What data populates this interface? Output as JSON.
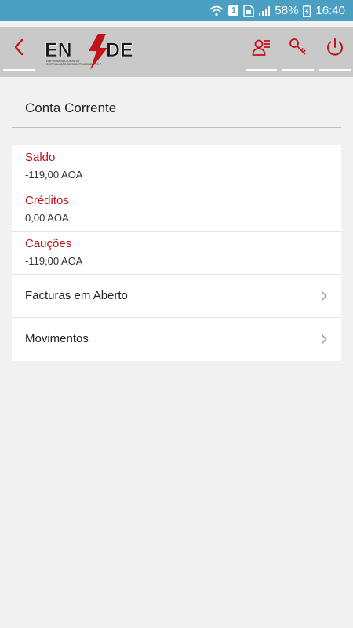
{
  "status_bar": {
    "sim_label": "1",
    "battery": "58%",
    "time": "16:40"
  },
  "header": {
    "logo_text": "ENDE",
    "logo_subtext": "EMPRESA NACIONAL DE DISTRIBUIÇÃO DE ELECTRICIDADE"
  },
  "page": {
    "title": "Conta Corrente"
  },
  "balances": [
    {
      "label": "Saldo",
      "value": "-119,00 AOA"
    },
    {
      "label": "Créditos",
      "value": "0,00 AOA"
    },
    {
      "label": "Cauções",
      "value": "-119,00 AOA"
    }
  ],
  "nav_items": [
    {
      "label": "Facturas em Aberto"
    },
    {
      "label": "Movimentos"
    }
  ],
  "colors": {
    "accent": "#b8141a",
    "status_bar": "#4a9fc3",
    "header_bg": "#c9c9c9"
  }
}
